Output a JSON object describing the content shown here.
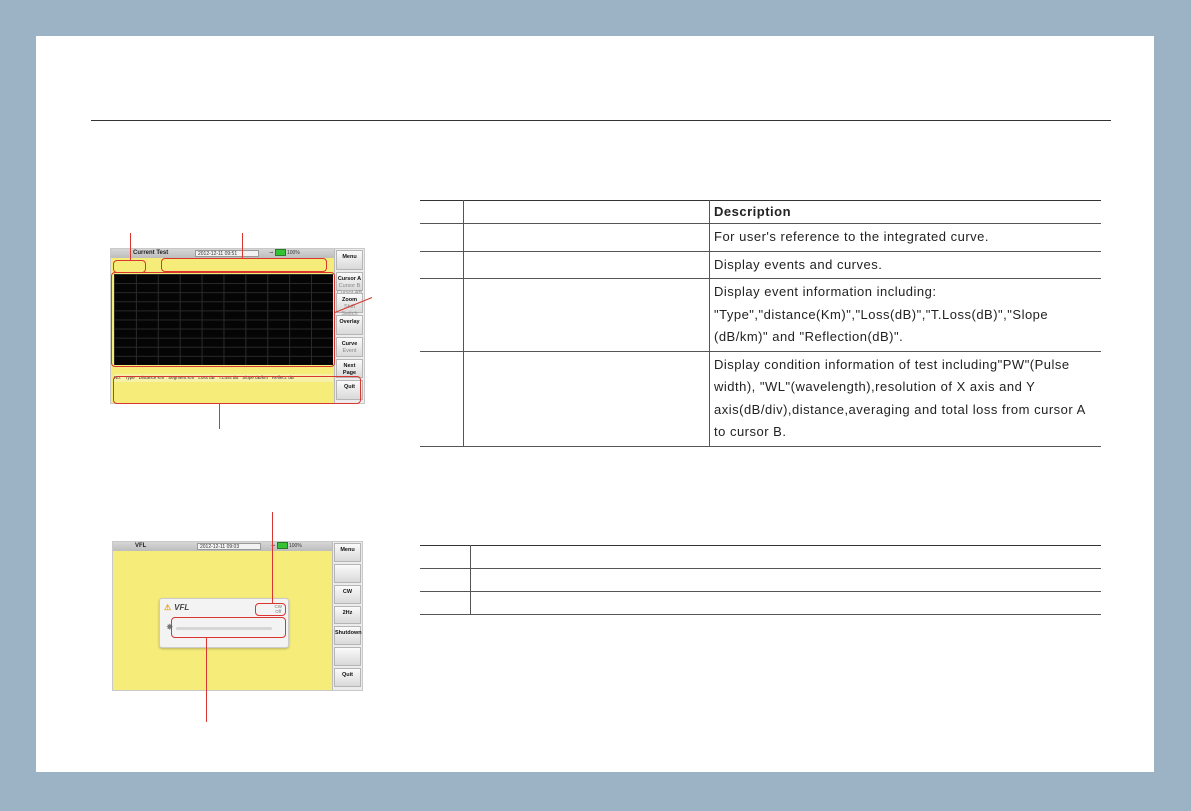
{
  "screen1": {
    "title": "Current Test",
    "date": "2012-12-11 09:51",
    "battery": "100%",
    "buttons": [
      {
        "label": "Menu",
        "sub": ""
      },
      {
        "label": "Cursor A",
        "sub": "Cursor B\nCursor AB"
      },
      {
        "label": "Zoom",
        "sub": "Shift\nSwitch"
      },
      {
        "label": "Overlay",
        "sub": ""
      },
      {
        "label": "Curve",
        "sub": "Event"
      },
      {
        "label": "Next Page",
        "sub": ""
      },
      {
        "label": "Quit",
        "sub": ""
      }
    ],
    "event_columns": [
      "No.",
      "Type",
      "Distance Km",
      "Segment Km",
      "Loss dB",
      "T.Loss dB",
      "Slope dB/km",
      "Reflect. dB"
    ]
  },
  "screen2": {
    "title": "VFL",
    "date": "2012-12-11 09:03",
    "battery": "100%",
    "panel_title": "VFL",
    "mode_label": "CW\nOff",
    "buttons": [
      {
        "label": "Menu"
      },
      {
        "label": ""
      },
      {
        "label": "CW"
      },
      {
        "label": "2Hz"
      },
      {
        "label": "Shutdown"
      },
      {
        "label": ""
      },
      {
        "label": "Quit"
      }
    ]
  },
  "table1": {
    "header": "Description",
    "rows": [
      "For user's reference to the integrated curve.",
      "Display events and curves.",
      "Display event information including: \"Type\",\"distance(Km)\",\"Loss(dB)\",\"T.Loss(dB)\",\"Slope (dB/km)\" and \"Reflection(dB)\".",
      "Display condition information of test including\"PW\"(Pulse width), \"WL\"(wavelength),resolution of X axis and Y axis(dB/div),distance,averaging and total loss from cursor A to cursor B."
    ]
  },
  "colors": {
    "screen_bg": "#f6ec7a",
    "callout": "#d9362f",
    "frame": "#9bb3c4"
  }
}
